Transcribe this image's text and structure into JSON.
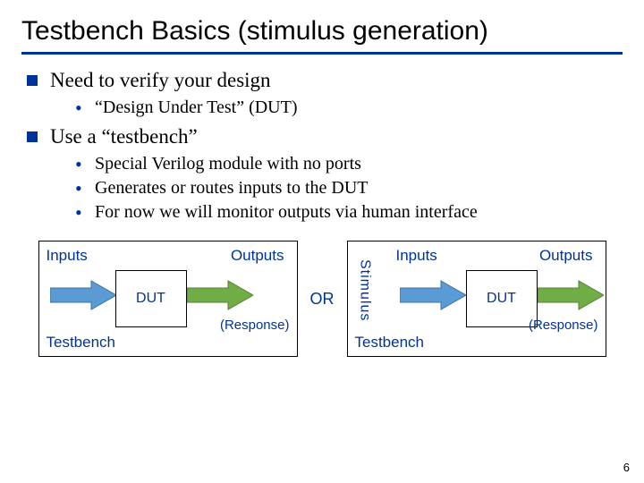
{
  "title": "Testbench Basics (stimulus generation)",
  "bullets": {
    "b1": "Need to verify your design",
    "b1_sub1": "“Design Under Test” (DUT)",
    "b2": "Use a “testbench”",
    "b2_sub1": "Special Verilog module with no ports",
    "b2_sub2": "Generates or routes inputs to the DUT",
    "b2_sub3": "For now we will monitor outputs via human interface"
  },
  "diagram": {
    "inputs": "Inputs",
    "outputs": "Outputs",
    "dut": "DUT",
    "response": "(Response)",
    "testbench": "Testbench",
    "or": "OR",
    "stimulus": "Stimulus"
  },
  "page_number": "6",
  "colors": {
    "accent": "#003399",
    "arrow_in": "#41719c",
    "arrow_out": "#548235"
  }
}
